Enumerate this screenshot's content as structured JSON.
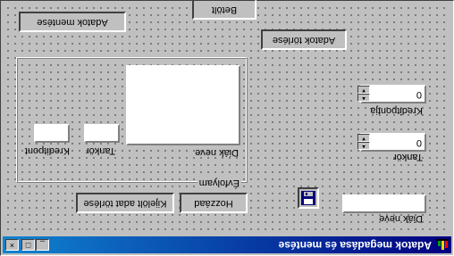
{
  "window": {
    "title": "Adatok megadása és mentése",
    "minimize_glyph": "_",
    "maximize_glyph": "□",
    "close_glyph": "×"
  },
  "form": {
    "diak_nev_label": "Diák neve",
    "diak_nev_value": "",
    "tankor_label": "Tankör",
    "tankor_value": "0",
    "kreditpont_label": "Kreditpontja",
    "kreditpont_value": "0",
    "adatok_torlese_button": "Adatok törlése",
    "betolt_button": "Betölt",
    "adatok_mentese_button": "Adatok mentése",
    "save_icon": "floppy-disk-icon"
  },
  "group": {
    "caption": "Évfolyam",
    "list_header_diak_nev": "Diák neve",
    "tankor_label": "Tankör",
    "kreditpont_label": "Kreditpont",
    "tankor_value": "",
    "kreditpont_value": ""
  },
  "bottom_buttons": {
    "hozzaad": "Hozzáad",
    "kijelolt_torlese": "Kijelölt adat törlése"
  },
  "colors": {
    "titlebar_start": "#000080",
    "titlebar_end": "#1084d0",
    "face": "#c0c0c0"
  }
}
